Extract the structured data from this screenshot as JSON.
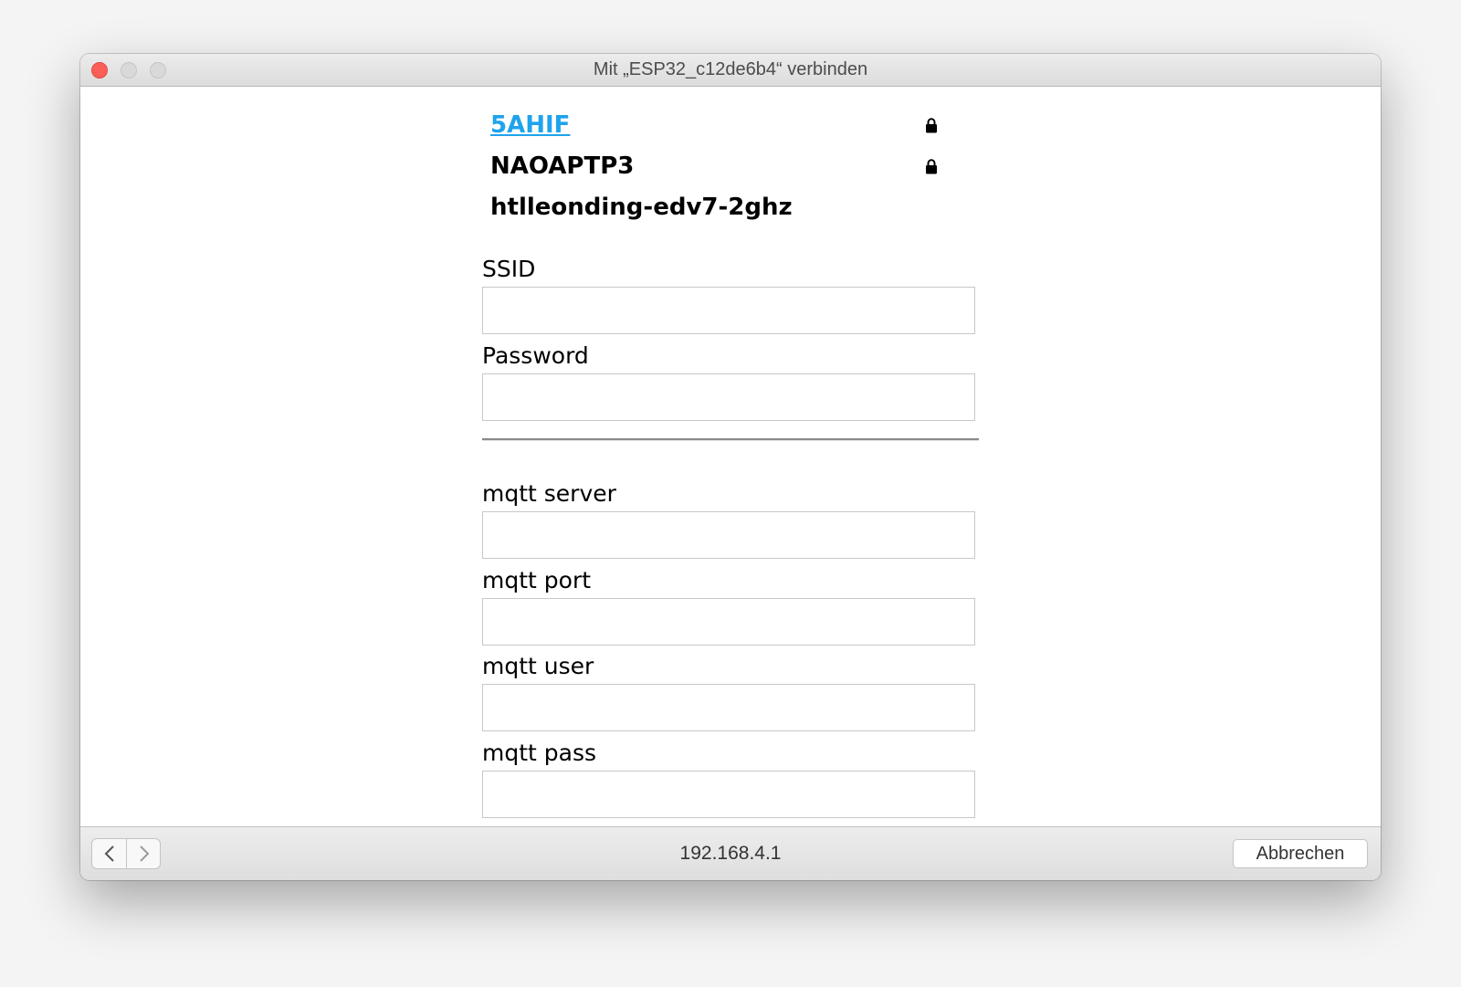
{
  "window": {
    "title": "Mit „ESP32_c12de6b4“ verbinden"
  },
  "networks": [
    {
      "name": "5AHIF",
      "secured": true,
      "link": true
    },
    {
      "name": "NAOAPTP3",
      "secured": true,
      "link": false
    },
    {
      "name": "htlleonding-edv7-2ghz",
      "secured": false,
      "link": false
    }
  ],
  "form": {
    "ssid_label": "SSID",
    "ssid_value": "",
    "password_label": "Password",
    "password_value": "",
    "mqtt_server_label": "mqtt server",
    "mqtt_server_value": "",
    "mqtt_port_label": "mqtt port",
    "mqtt_port_value": "",
    "mqtt_user_label": "mqtt user",
    "mqtt_user_value": "",
    "mqtt_pass_label": "mqtt pass",
    "mqtt_pass_value": ""
  },
  "bottombar": {
    "url": "192.168.4.1",
    "cancel_label": "Abbrechen"
  },
  "colors": {
    "link": "#1fa3ec",
    "close": "#fc5f57"
  },
  "icons": {
    "lock": "lock-icon",
    "back": "chevron-left-icon",
    "forward": "chevron-right-icon"
  }
}
